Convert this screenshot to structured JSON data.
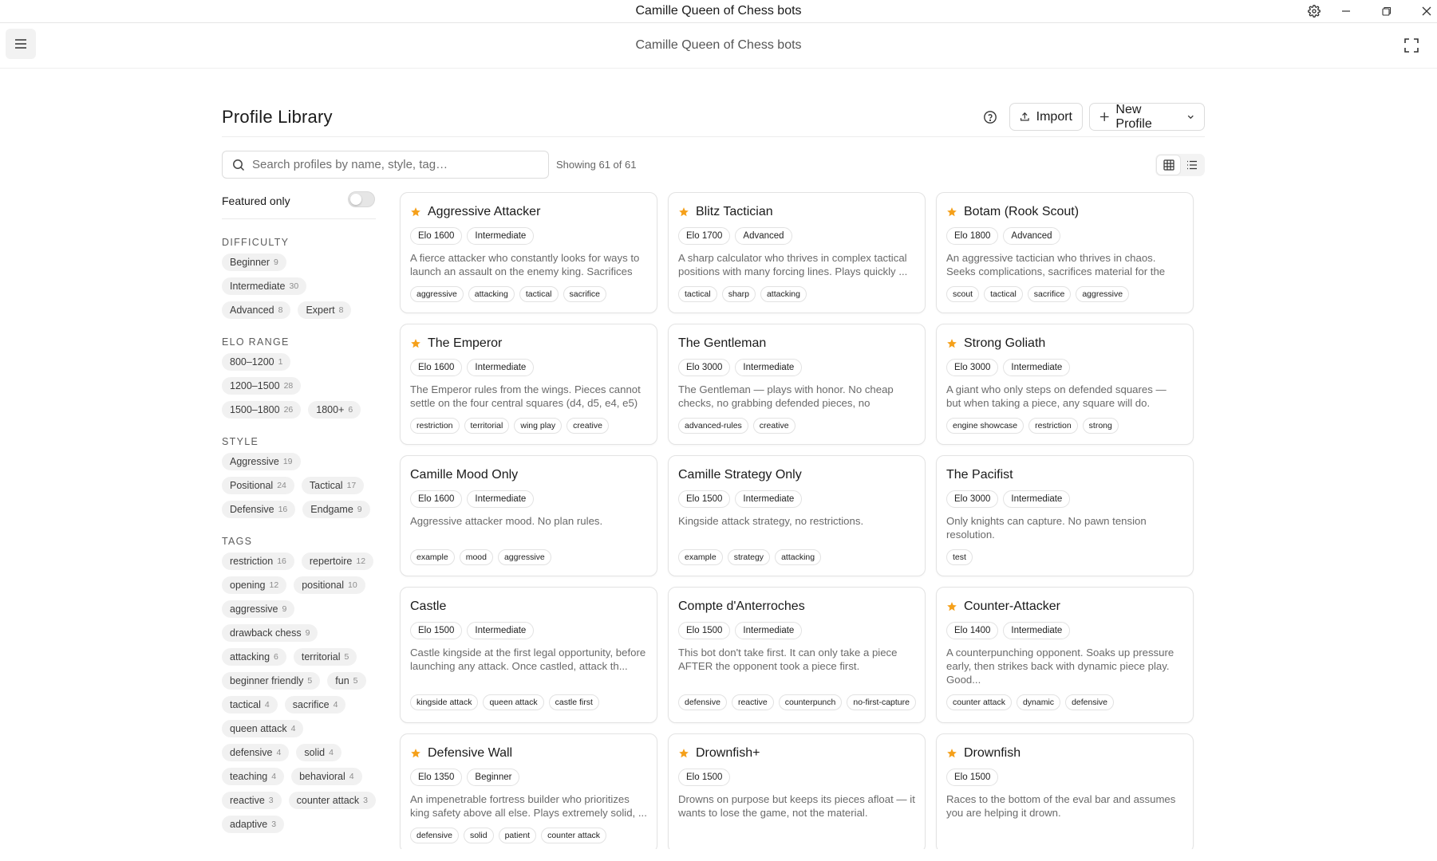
{
  "window": {
    "title": "Camille Queen of Chess bots"
  },
  "app": {
    "title": "Camille Queen of Chess bots"
  },
  "page": {
    "title": "Profile Library",
    "import_label": "Import",
    "new_profile_label": "New Profile"
  },
  "search": {
    "placeholder": "Search profiles by name, style, tag…",
    "value": ""
  },
  "showing": "Showing 61 of 61",
  "sidebar": {
    "featured_label": "Featured only",
    "featured_on": false,
    "sections": [
      {
        "title": "DIFFICULTY",
        "chips": [
          {
            "label": "Beginner",
            "count": "9"
          },
          {
            "label": "Intermediate",
            "count": "30"
          },
          {
            "label": "Advanced",
            "count": "8"
          },
          {
            "label": "Expert",
            "count": "8"
          }
        ]
      },
      {
        "title": "ELO RANGE",
        "chips": [
          {
            "label": "800–1200",
            "count": "1"
          },
          {
            "label": "1200–1500",
            "count": "28"
          },
          {
            "label": "1500–1800",
            "count": "26"
          },
          {
            "label": "1800+",
            "count": "6"
          }
        ]
      },
      {
        "title": "STYLE",
        "chips": [
          {
            "label": "Aggressive",
            "count": "19"
          },
          {
            "label": "Positional",
            "count": "24"
          },
          {
            "label": "Tactical",
            "count": "17"
          },
          {
            "label": "Defensive",
            "count": "16"
          },
          {
            "label": "Endgame",
            "count": "9"
          }
        ]
      },
      {
        "title": "TAGS",
        "chips": [
          {
            "label": "restriction",
            "count": "16"
          },
          {
            "label": "repertoire",
            "count": "12"
          },
          {
            "label": "opening",
            "count": "12"
          },
          {
            "label": "positional",
            "count": "10"
          },
          {
            "label": "aggressive",
            "count": "9"
          },
          {
            "label": "drawback chess",
            "count": "9"
          },
          {
            "label": "attacking",
            "count": "6"
          },
          {
            "label": "territorial",
            "count": "5"
          },
          {
            "label": "beginner friendly",
            "count": "5"
          },
          {
            "label": "fun",
            "count": "5"
          },
          {
            "label": "tactical",
            "count": "4"
          },
          {
            "label": "sacrifice",
            "count": "4"
          },
          {
            "label": "queen attack",
            "count": "4"
          },
          {
            "label": "defensive",
            "count": "4"
          },
          {
            "label": "solid",
            "count": "4"
          },
          {
            "label": "teaching",
            "count": "4"
          },
          {
            "label": "behavioral",
            "count": "4"
          },
          {
            "label": "reactive",
            "count": "3"
          },
          {
            "label": "counter attack",
            "count": "3"
          },
          {
            "label": "adaptive",
            "count": "3"
          }
        ]
      }
    ]
  },
  "colors": {
    "star": "#f5a01a",
    "border": "#e3e3e3",
    "chip_bg": "#f1f1f1"
  },
  "profiles": [
    {
      "name": "Aggressive Attacker",
      "featured": true,
      "elo": "Elo 1600",
      "level": "Intermediate",
      "desc": "A fierce attacker who constantly looks for ways to launch an assault on the enemy king. Sacrifices m...",
      "tags": [
        "aggressive",
        "attacking",
        "tactical",
        "sacrifice"
      ]
    },
    {
      "name": "Blitz Tactician",
      "featured": true,
      "elo": "Elo 1700",
      "level": "Advanced",
      "desc": "A sharp calculator who thrives in complex tactical positions with many forcing lines. Plays quickly ...",
      "tags": [
        "tactical",
        "sharp",
        "attacking"
      ]
    },
    {
      "name": "Botam (Rook Scout)",
      "featured": true,
      "elo": "Elo 1800",
      "level": "Advanced",
      "desc": "An aggressive tactician who thrives in chaos. Seeks complications, sacrifices material for the initi...",
      "tags": [
        "scout",
        "tactical",
        "sacrifice",
        "aggressive"
      ]
    },
    {
      "name": "The Emperor",
      "featured": true,
      "elo": "Elo 1600",
      "level": "Intermediate",
      "desc": "The Emperor rules from the wings. Pieces cannot settle on the four central squares (d4, d5, e4, e5) ...",
      "tags": [
        "restriction",
        "territorial",
        "wing play",
        "creative"
      ]
    },
    {
      "name": "The Gentleman",
      "featured": false,
      "elo": "Elo 3000",
      "level": "Intermediate",
      "desc": "The Gentleman — plays with honor. No cheap checks, no grabbing defended pieces, no blunders.",
      "tags": [
        "advanced-rules",
        "creative"
      ]
    },
    {
      "name": "Strong Goliath",
      "featured": true,
      "elo": "Elo 3000",
      "level": "Intermediate",
      "desc": "A giant who only steps on defended squares — but when taking a piece, any square will do. Stronger t...",
      "tags": [
        "engine showcase",
        "restriction",
        "strong"
      ]
    },
    {
      "name": "Camille Mood Only",
      "featured": false,
      "elo": "Elo 1600",
      "level": "Intermediate",
      "desc": "Aggressive attacker mood. No plan rules.",
      "tags": [
        "example",
        "mood",
        "aggressive"
      ]
    },
    {
      "name": "Camille Strategy Only",
      "featured": false,
      "elo": "Elo 1500",
      "level": "Intermediate",
      "desc": "Kingside attack strategy, no restrictions.",
      "tags": [
        "example",
        "strategy",
        "attacking"
      ]
    },
    {
      "name": "The Pacifist",
      "featured": false,
      "elo": "Elo 3000",
      "level": "Intermediate",
      "desc": "Only knights can capture. No pawn tension resolution.",
      "tags": [
        "test"
      ]
    },
    {
      "name": "Castle",
      "featured": false,
      "elo": "Elo 1500",
      "level": "Intermediate",
      "desc": "Castle kingside at the first legal opportunity, before launching any attack. Once castled, attack th...",
      "tags": [
        "kingside attack",
        "queen attack",
        "castle first"
      ]
    },
    {
      "name": "Compte d'Anterroches",
      "featured": false,
      "elo": "Elo 1500",
      "level": "Intermediate",
      "desc": "This bot don't take first. It can only take a piece AFTER the opponent took a piece first.",
      "tags": [
        "defensive",
        "reactive",
        "counterpunch",
        "no-first-capture"
      ]
    },
    {
      "name": "Counter-Attacker",
      "featured": true,
      "elo": "Elo 1400",
      "level": "Intermediate",
      "desc": "A counterpunching opponent. Soaks up pressure early, then strikes back with dynamic piece play. Good...",
      "tags": [
        "counter attack",
        "dynamic",
        "defensive"
      ]
    },
    {
      "name": "Defensive Wall",
      "featured": true,
      "elo": "Elo 1350",
      "level": "Beginner",
      "desc": "An impenetrable fortress builder who prioritizes king safety above all else. Plays extremely solid, ...",
      "tags": [
        "defensive",
        "solid",
        "patient",
        "counter attack"
      ]
    },
    {
      "name": "Drownfish+",
      "featured": true,
      "elo": "Elo 1500",
      "level": "",
      "desc": "Drowns on purpose but keeps its pieces afloat — it wants to lose the game, not the material.",
      "tags": []
    },
    {
      "name": "Drownfish",
      "featured": true,
      "elo": "Elo 1500",
      "level": "",
      "desc": "Races to the bottom of the eval bar and assumes you are helping it drown.",
      "tags": []
    }
  ]
}
